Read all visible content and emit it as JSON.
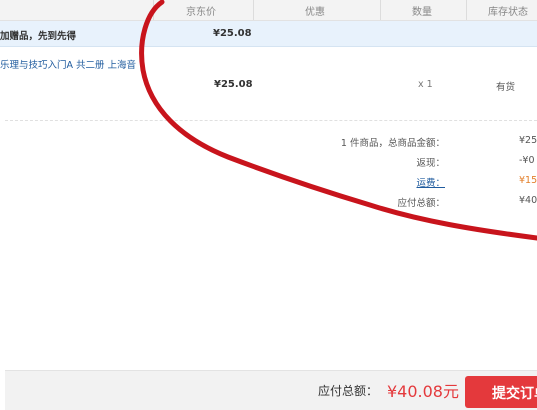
{
  "table_header": {
    "price": "京东价",
    "discount": "优惠",
    "quantity": "数量",
    "stock": "库存状态"
  },
  "promo_row": {
    "text": "加赠品，先到先得",
    "price": "¥25.08"
  },
  "item": {
    "title": "乐理与技巧入门A 共二册 上海音",
    "price": "¥25.08",
    "quantity": "x 1",
    "stock": "有货"
  },
  "summary": {
    "goods_label": "1 件商品，总商品金额：",
    "goods_value": "¥25",
    "cashback_label": "返现：",
    "cashback_value": "-¥0",
    "freight_label": "运费：",
    "freight_value": "¥15",
    "payable_label": "应付总额：",
    "payable_value": "¥40"
  },
  "footer": {
    "total_label": "应付总额：",
    "total_value": "¥40.08元",
    "submit_label": "提交订单"
  },
  "colors": {
    "accent_red": "#e4393c",
    "link_blue": "#1f5b9e",
    "freight_orange": "#e37f2a",
    "annotation_red": "#c8141c"
  }
}
